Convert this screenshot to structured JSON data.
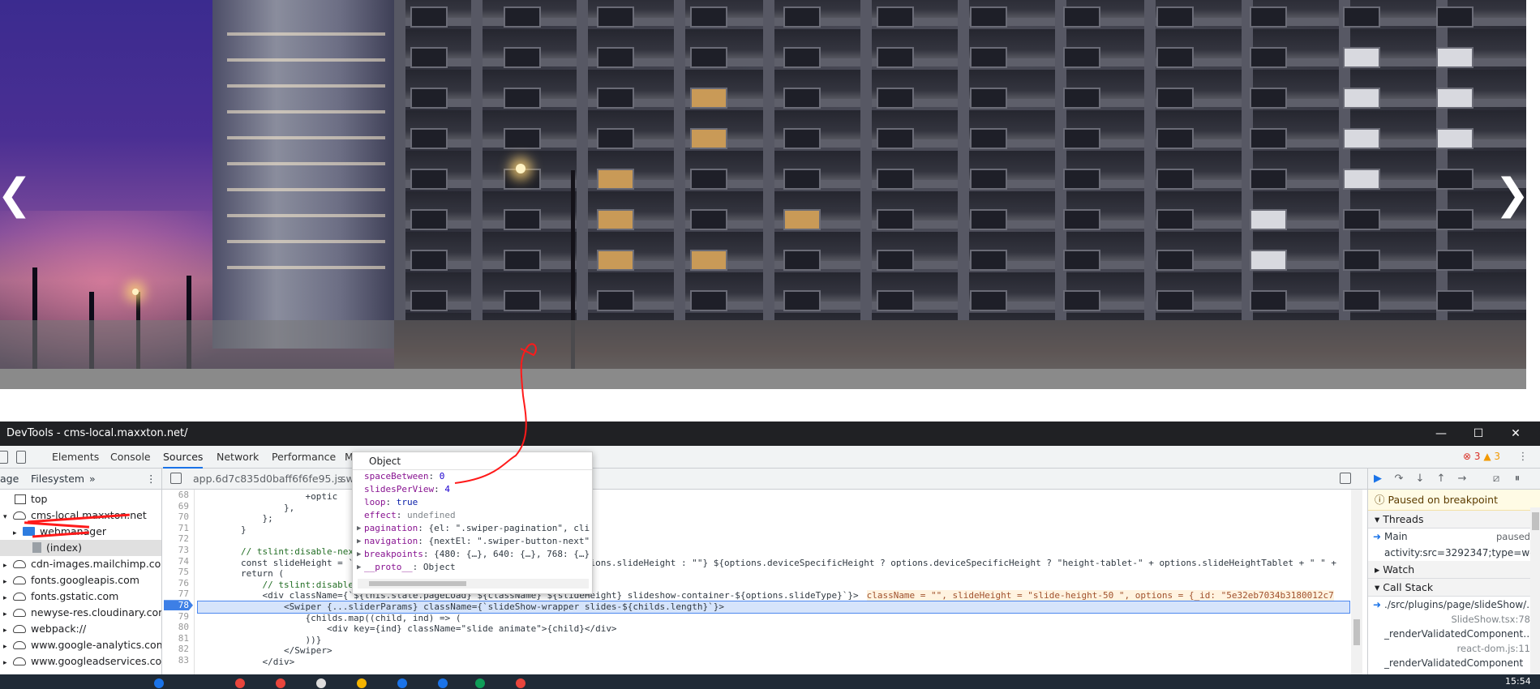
{
  "hero": {
    "prev_arrow": "❮",
    "next_arrow": "❯"
  },
  "devtools": {
    "title": "DevTools - cms-local.maxxton.net/",
    "window_controls": {
      "minimize": "—",
      "maximize": "☐",
      "close": "✕"
    },
    "tabs": [
      "Elements",
      "Console",
      "Sources",
      "Network",
      "Performance",
      "M"
    ],
    "active_tab": "Sources",
    "errors": "3",
    "warnings": "3",
    "navigator": {
      "tab_page": "age",
      "tab_filesystem": "Filesystem",
      "more": "»",
      "items": [
        {
          "label": "top",
          "icon": "frame"
        },
        {
          "label": "cms-local.maxxton.net",
          "icon": "cloud"
        },
        {
          "label": "webmanager",
          "icon": "folder"
        },
        {
          "label": "(index)",
          "icon": "file"
        },
        {
          "label": "cdn-images.mailchimp.com",
          "icon": "cloud"
        },
        {
          "label": "fonts.googleapis.com",
          "icon": "cloud"
        },
        {
          "label": "fonts.gstatic.com",
          "icon": "cloud"
        },
        {
          "label": "newyse-res.cloudinary.com",
          "icon": "cloud"
        },
        {
          "label": "webpack://",
          "icon": "cloud"
        },
        {
          "label": "www.google-analytics.com",
          "icon": "cloud"
        },
        {
          "label": "www.googleadservices.com",
          "icon": "cloud"
        }
      ]
    },
    "editor": {
      "file_tab": "app.6d7c835d0baff6f6fe95.js",
      "file_tab_2": "sw",
      "lines": [
        {
          "n": "68",
          "code": "                    +optic"
        },
        {
          "n": "69",
          "code": "                },"
        },
        {
          "n": "70",
          "code": "            };"
        },
        {
          "n": "71",
          "code": "        }"
        },
        {
          "n": "72",
          "code": ""
        },
        {
          "n": "73",
          "code": "        // tslint:disable-next"
        },
        {
          "n": "74",
          "code": "        const slideHeight = `$                                        options.slideHeight : \"\"} ${options.deviceSpecificHeight ? options.deviceSpecificHeight ? \"height-tablet-\" + options.slideHeightTablet + \" \" +"
        },
        {
          "n": "75",
          "code": "        return ("
        },
        {
          "n": "76",
          "code": "            // tslint:disable-"
        },
        {
          "n": "77",
          "code": "            <div className={`${this.state.pageLoad} ${className} ${slideHeight} slideshow-container-${options.slideType}`}>"
        },
        {
          "n": "78",
          "code": "                <Swiper {...sliderParams} className={`slideShow-wrapper slides-${childs.length}`}>"
        },
        {
          "n": "79",
          "code": "                    {childs.map((child, ind) => ("
        },
        {
          "n": "80",
          "code": "                        <div key={ind} className=\"slide animate\">{child}</div>"
        },
        {
          "n": "81",
          "code": "                    ))}"
        },
        {
          "n": "82",
          "code": "                </Swiper>"
        },
        {
          "n": "83",
          "code": "            </div>"
        }
      ],
      "inline_value": "className = \"\", slideHeight = \"slide-height-50 \", options = {_id: \"5e32eb7034b3180012c7",
      "breakpoint_line": "78"
    },
    "popover": {
      "title": "Object",
      "rows": [
        {
          "key": "spaceBetween",
          "value": "0",
          "kind": "num",
          "expandable": false
        },
        {
          "key": "slidesPerView",
          "value": "4",
          "kind": "num",
          "expandable": false
        },
        {
          "key": "loop",
          "value": "true",
          "kind": "bool",
          "expandable": false
        },
        {
          "key": "effect",
          "value": "undefined",
          "kind": "undef",
          "expandable": false
        },
        {
          "key": "pagination",
          "value": "{el: \".swiper-pagination\", cli",
          "kind": "obj",
          "expandable": true
        },
        {
          "key": "navigation",
          "value": "{nextEl: \".swiper-button-next\"",
          "kind": "obj",
          "expandable": true
        },
        {
          "key": "breakpoints",
          "value": "{480: {…}, 640: {…}, 768: {…}",
          "kind": "obj",
          "expandable": true
        },
        {
          "key": "__proto__",
          "value": "Object",
          "kind": "obj",
          "expandable": true
        }
      ]
    },
    "debugger": {
      "paused_text": "Paused on breakpoint",
      "threads_label": "Threads",
      "thread_main": "Main",
      "thread_status": "paused",
      "thread_src": "activity:src=3292347;type=we…",
      "watch_label": "Watch",
      "callstack_label": "Call Stack",
      "frames": [
        {
          "name": "./src/plugins/page/slideShow/…",
          "loc": "SlideShow.tsx:78"
        },
        {
          "name": "_renderValidatedComponent…",
          "loc": "react-dom.js:11"
        },
        {
          "name": "_renderValidatedComponent",
          "loc": ""
        }
      ]
    }
  },
  "taskbar": {
    "clock": "15:54"
  }
}
